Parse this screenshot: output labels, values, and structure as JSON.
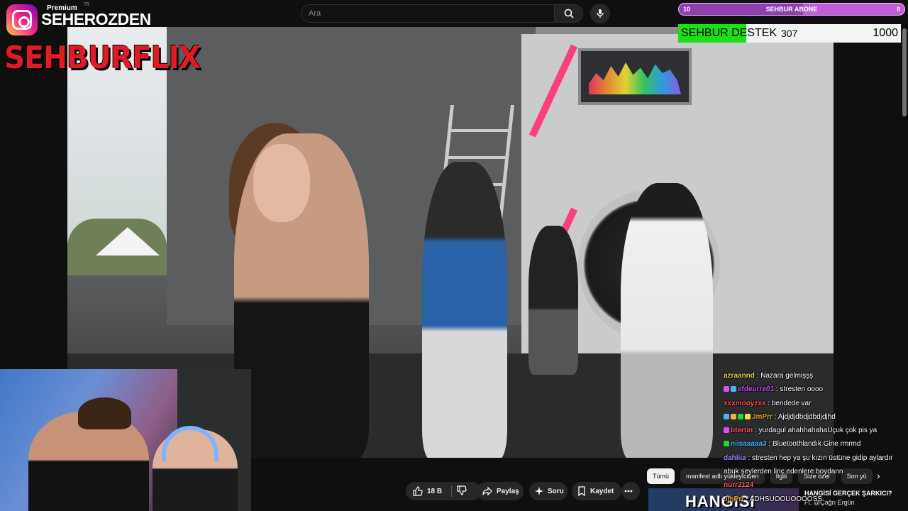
{
  "header": {
    "premium_label": "Premium",
    "region": "TR",
    "search_placeholder": "Ara"
  },
  "brand": {
    "handle": "SEHEROZDEN",
    "title": "SEHBURFLIX"
  },
  "widgets": {
    "subscriber_goal": {
      "left": "10",
      "label": "SEHBUR ABONE",
      "right": "8",
      "progress": 0.55
    },
    "donation_goal": {
      "label": "SEHBUR DESTEK",
      "current": "307",
      "target": "1000",
      "progress": 0.307
    }
  },
  "actions": {
    "like_count": "18 B",
    "share": "Paylaş",
    "ask": "Soru",
    "save": "Kaydet"
  },
  "chips": [
    "Tümü",
    "manifest adlı yükleyiciden",
    "İlgili",
    "Size özel",
    "Son yü"
  ],
  "recommendation": {
    "thumb_text": "HANGISI",
    "title": "HANGİSİ GERÇEK ŞARKICI?",
    "channel": "Ft. @Çağrı Ergün"
  },
  "chat": [
    {
      "user": "azraannd",
      "text": "Nazara gelmişşş",
      "color": "#e8d24a",
      "badges": []
    },
    {
      "user": "efdeurre01",
      "text": "stresten oooo",
      "color": "#c24cff",
      "badges": [
        "#e04cff",
        "#4cb3ff"
      ]
    },
    {
      "user": "xxxmooyzxx",
      "text": "bendede var",
      "color": "#ff4c4c",
      "badges": []
    },
    {
      "user": "JmPrr",
      "text": "Ajdjdjdbdjdbdjdjhd",
      "color": "#e8a23a",
      "badges": [
        "#4cb3ff",
        "#f2b33a",
        "#19e019",
        "#ffdd33"
      ]
    },
    {
      "user": "btertin",
      "text": "yurdagul ahahhahahaUçuk çok pis ya",
      "color": "#ff5a5a",
      "badges": [
        "#e04cff"
      ]
    },
    {
      "user": "niisaaaaa3",
      "text": "Bluetoothlandık Gine rmrmd",
      "color": "#4cb3ff",
      "badges": [
        "#19e019"
      ]
    },
    {
      "user": "dahliia",
      "text": "stresten hep ya şu kızın üstüne gidip aylardır",
      "color": "#aa88ff",
      "badges": []
    },
    {
      "user": "",
      "text": "abuk şeylerden linç edenlere boydann",
      "color": "#ffffff",
      "badges": []
    },
    {
      "user": "nurr2124",
      "text": "",
      "color": "#ff5a5a",
      "badges": []
    },
    {
      "user": "JmPrr",
      "text": "ADHSUOOUOOOOSS",
      "color": "#e8a23a",
      "badges": []
    }
  ],
  "colors": {
    "accent_red": "#e01b24",
    "background": "#0f0f0f",
    "pill": "#272727",
    "goal_green": "#19e019",
    "goal_purple": "#c15ed8"
  }
}
